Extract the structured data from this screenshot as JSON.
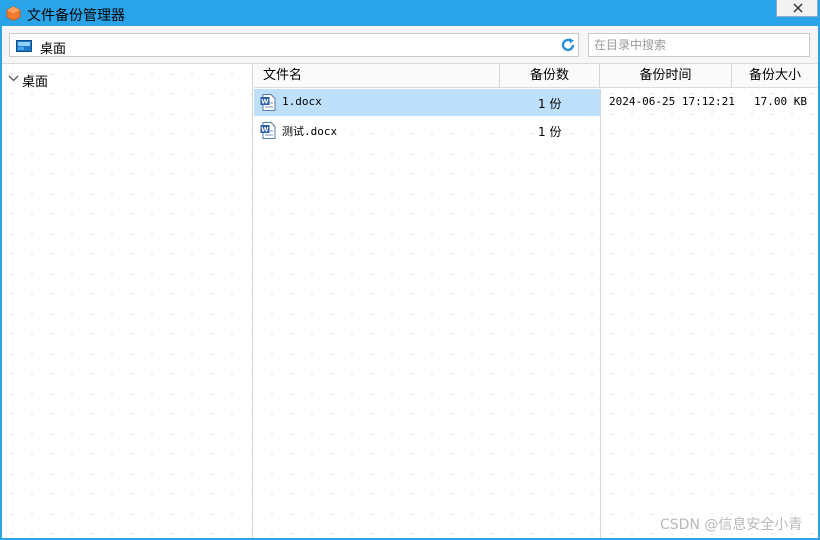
{
  "window": {
    "title": "文件备份管理器",
    "accent": "#2aa4e8"
  },
  "toolbar": {
    "path": "桌面",
    "search_placeholder": "在目录中搜索"
  },
  "tree": {
    "root_label": "桌面"
  },
  "table": {
    "columns": {
      "name": "文件名",
      "count": "备份数",
      "time": "备份时间",
      "size": "备份大小"
    },
    "rows": [
      {
        "name": "1.docx",
        "count": "1 份",
        "selected": true
      },
      {
        "name": "测试.docx",
        "count": "1 份",
        "selected": false
      }
    ],
    "detail": {
      "time": "2024-06-25 17:12:21",
      "size": "17.00 KB"
    }
  },
  "watermark": "CSDN @信息安全小青",
  "icons": {
    "app": "app-icon",
    "close": "close-icon",
    "folder": "desktop-folder-icon",
    "refresh": "refresh-icon",
    "expand": "chevron-down-icon",
    "file": "word-document-icon"
  }
}
